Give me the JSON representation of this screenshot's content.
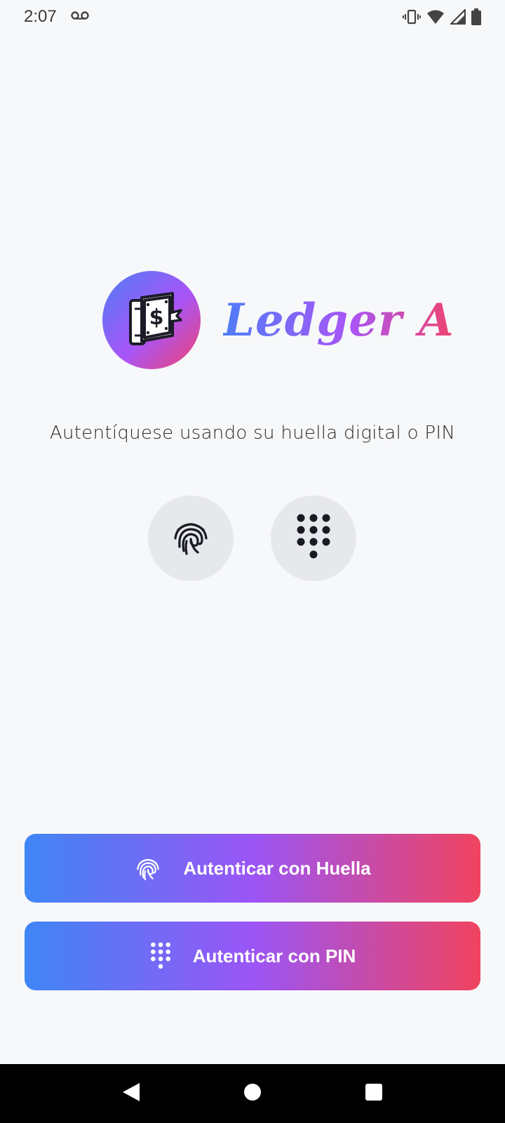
{
  "status_bar": {
    "time": "2:07",
    "icons": [
      "voicemail-icon",
      "vibrate-icon",
      "wifi-icon",
      "signal-icon",
      "battery-icon"
    ]
  },
  "app": {
    "name": "Ledger A",
    "logo_icon": "ledger-book-dollar-icon",
    "subtitle": "Autentíquese usando su huella digital o PIN"
  },
  "quick_actions": [
    {
      "icon": "fingerprint-icon"
    },
    {
      "icon": "dialpad-icon"
    }
  ],
  "buttons": {
    "fingerprint_label": "Autenticar con Huella",
    "pin_label": "Autenticar con PIN"
  },
  "colors": {
    "gradient_start": "#3f86f6",
    "gradient_mid": "#9b55f6",
    "gradient_end": "#f1435f",
    "background": "#f7f8fa",
    "quick_button_bg": "#e6e8ec"
  },
  "nav_bar": {
    "icons": [
      "back-icon",
      "home-icon",
      "recents-icon"
    ]
  }
}
